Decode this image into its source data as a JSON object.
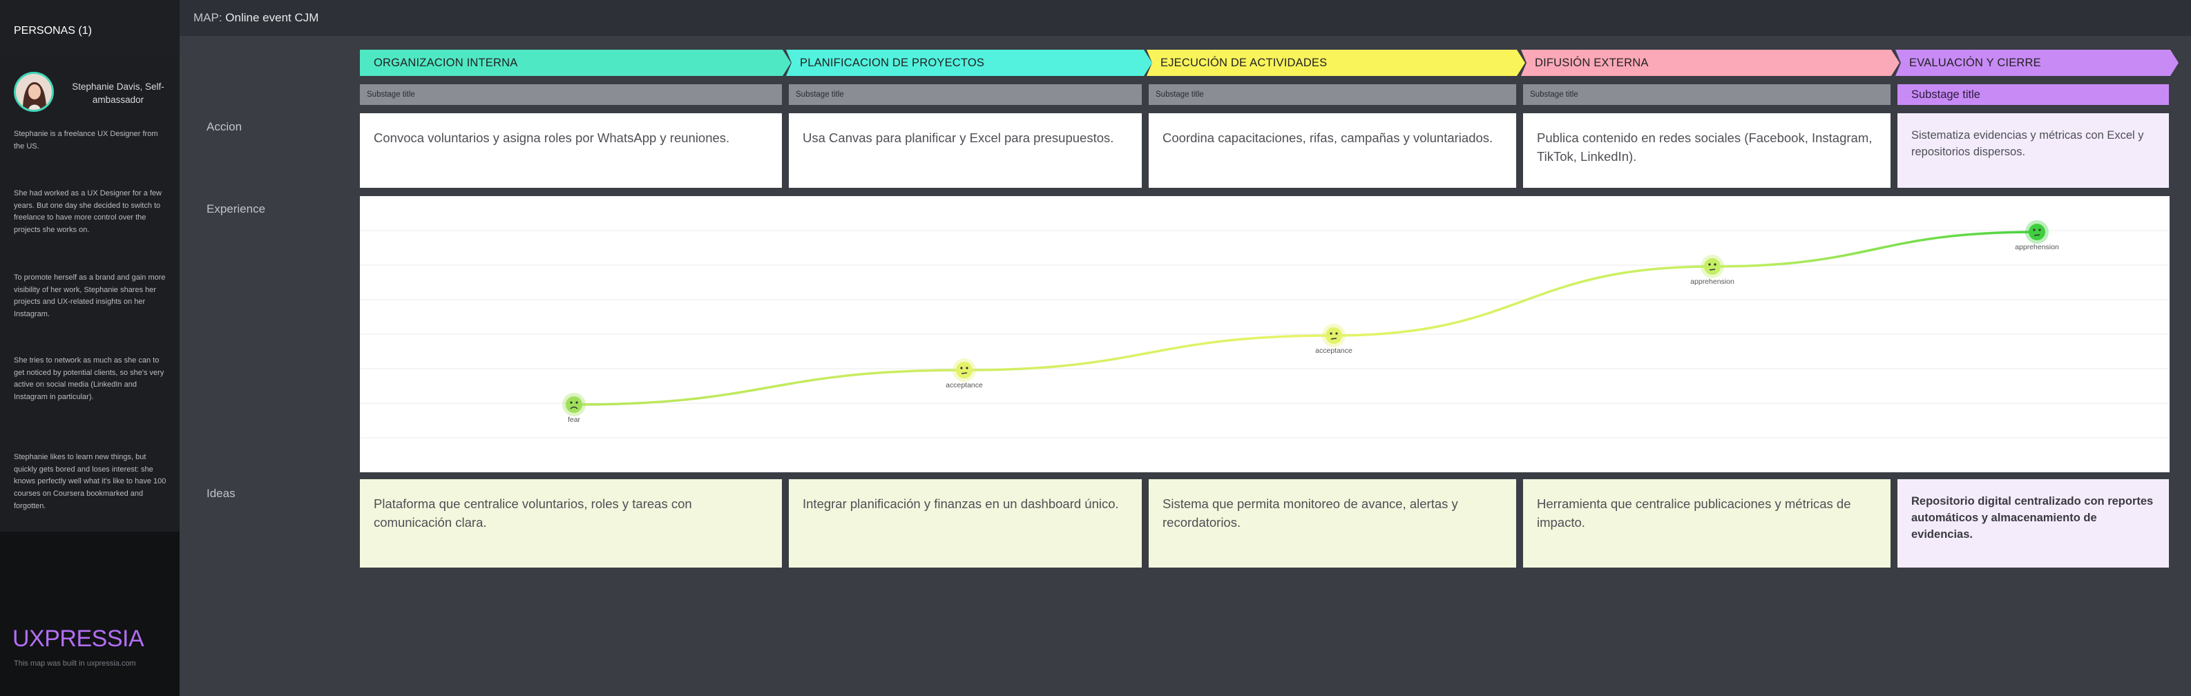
{
  "sidebar": {
    "title": "PERSONAS (1)",
    "persona": {
      "name": "Stephanie Davis, Self-ambassador",
      "bio": [
        "Stephanie is a freelance UX Designer from the US.",
        "She had worked as a UX Designer for a few years. But one day she decided to switch to freelance to have more control over the projects she works on.",
        "To promote herself as a brand and gain more visibility of her work, Stephanie shares her projects and UX-related insights on her Instagram.",
        "She tries to network as much as she can to get noticed by potential clients, so she's very active on social media (LinkedIn and Instagram in particular).",
        "Stephanie likes to learn new things, but quickly gets bored and loses interest: she knows perfectly well what it's like to have 100 courses on Coursera bookmarked and forgotten."
      ]
    },
    "logo": "UXPRESSIA",
    "footer": "This map was built in uxpressia.com"
  },
  "topbar": {
    "prefix": "MAP:",
    "map_name": "Online event CJM"
  },
  "stages": [
    {
      "label": "ORGANIZACION INTERNA",
      "color": "#4fe8c4",
      "substage": "Substage title"
    },
    {
      "label": "PLANIFICACION DE PROYECTOS",
      "color": "#52f2de",
      "substage": "Substage title"
    },
    {
      "label": "EJECUCIÓN DE ACTIVIDADES",
      "color": "#f9f45a",
      "substage": "Substage title"
    },
    {
      "label": "DIFUSIÓN EXTERNA",
      "color": "#fba8b8",
      "substage": "Substage title"
    },
    {
      "label": "EVALUACIÓN Y CIERRE",
      "color": "#c88bf6",
      "substage": "Substage title"
    }
  ],
  "rows": {
    "accion_label": "Accion",
    "experience_label": "Experience",
    "ideas_label": "Ideas"
  },
  "accion": [
    "Convoca voluntarios y asigna roles por WhatsApp y reuniones.",
    "Usa Canvas para planificar y Excel para presupuestos.",
    "Coordina capacitaciones, rifas, campañas y voluntariados.",
    "Publica contenido en redes sociales (Facebook, Instagram, TikTok, LinkedIn).",
    "Sistematiza evidencias y métricas con Excel y repositorios dispersos."
  ],
  "ideas": [
    "Plataforma que centralice voluntarios, roles y tareas con comunicación clara.",
    "Integrar planificación y finanzas en un dashboard único.",
    "Sistema que permita monitoreo de avance, alertas y recordatorios.",
    "Herramienta que centralice publicaciones y métricas de impacto.",
    "Repositorio digital centralizado con reportes automáticos y almacenamiento de evidencias."
  ],
  "experience": {
    "levels": 7,
    "points": [
      {
        "emotion": "fear",
        "level": 2,
        "color": "#9ee05a",
        "face": "sad"
      },
      {
        "emotion": "acceptance",
        "level": 3,
        "color": "#e4f26a",
        "face": "neutral"
      },
      {
        "emotion": "acceptance",
        "level": 4,
        "color": "#e4f26a",
        "face": "neutral"
      },
      {
        "emotion": "apprehension",
        "level": 6,
        "color": "#c4ee64",
        "face": "neutral"
      },
      {
        "emotion": "apprehension",
        "level": 7,
        "color": "#3ecf3e",
        "face": "neutral"
      }
    ]
  }
}
